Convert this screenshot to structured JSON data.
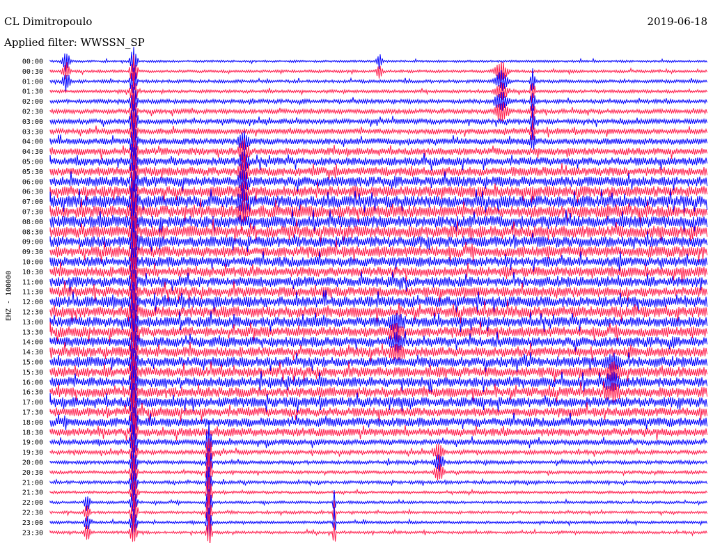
{
  "header": {
    "station": "CL Dimitropoulo",
    "date": "2019-06-18",
    "filter": "Applied filter: WWSSN_SP"
  },
  "chart_data": {
    "type": "line",
    "ylabel": "EHZ - 100000",
    "row_labels": [
      "00:00",
      "00:30",
      "01:00",
      "01:30",
      "02:00",
      "02:30",
      "03:00",
      "03:30",
      "04:00",
      "04:30",
      "05:00",
      "05:30",
      "06:00",
      "06:30",
      "07:00",
      "07:30",
      "08:00",
      "08:30",
      "09:00",
      "09:30",
      "10:00",
      "10:30",
      "11:00",
      "11:30",
      "12:00",
      "12:30",
      "13:00",
      "13:30",
      "14:00",
      "14:30",
      "15:00",
      "15:30",
      "16:00",
      "16:30",
      "17:00",
      "17:30",
      "18:00",
      "18:30",
      "19:00",
      "19:30",
      "20:00",
      "20:30",
      "21:00",
      "21:30",
      "22:00",
      "22:30",
      "23:00",
      "23:30"
    ],
    "row_colors": [
      "#0000ff",
      "#ff1a4a"
    ],
    "row_amplitude": [
      0.25,
      0.3,
      0.35,
      0.35,
      0.45,
      0.5,
      0.55,
      0.6,
      0.7,
      0.8,
      0.9,
      1.0,
      1.1,
      1.2,
      1.3,
      1.3,
      1.3,
      1.3,
      1.2,
      1.2,
      1.1,
      1.1,
      1.1,
      1.1,
      1.2,
      1.2,
      1.1,
      1.1,
      1.1,
      1.1,
      1.1,
      1.1,
      1.1,
      1.1,
      1.1,
      1.0,
      1.0,
      0.9,
      0.6,
      0.45,
      0.4,
      0.35,
      0.35,
      0.3,
      0.3,
      0.3,
      0.3,
      0.3
    ]
  }
}
